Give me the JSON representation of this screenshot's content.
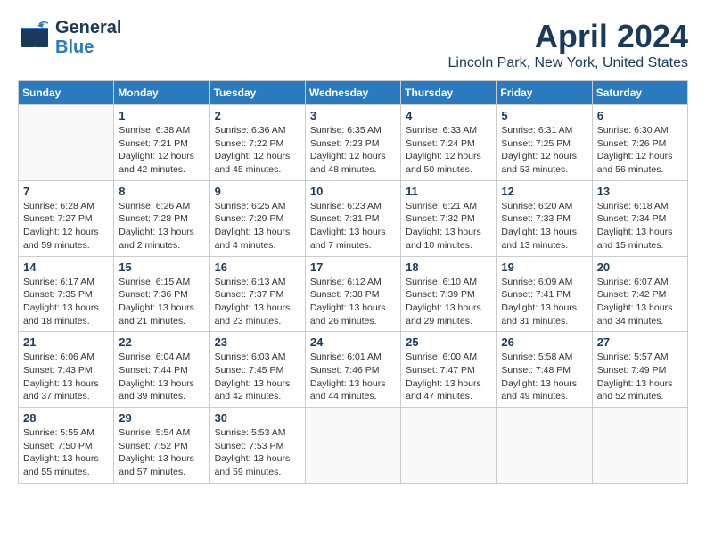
{
  "header": {
    "logo_line1": "General",
    "logo_line2": "Blue",
    "title": "April 2024",
    "subtitle": "Lincoln Park, New York, United States"
  },
  "weekdays": [
    "Sunday",
    "Monday",
    "Tuesday",
    "Wednesday",
    "Thursday",
    "Friday",
    "Saturday"
  ],
  "weeks": [
    [
      {
        "day": "",
        "sunrise": "",
        "sunset": "",
        "daylight": ""
      },
      {
        "day": "1",
        "sunrise": "Sunrise: 6:38 AM",
        "sunset": "Sunset: 7:21 PM",
        "daylight": "Daylight: 12 hours and 42 minutes."
      },
      {
        "day": "2",
        "sunrise": "Sunrise: 6:36 AM",
        "sunset": "Sunset: 7:22 PM",
        "daylight": "Daylight: 12 hours and 45 minutes."
      },
      {
        "day": "3",
        "sunrise": "Sunrise: 6:35 AM",
        "sunset": "Sunset: 7:23 PM",
        "daylight": "Daylight: 12 hours and 48 minutes."
      },
      {
        "day": "4",
        "sunrise": "Sunrise: 6:33 AM",
        "sunset": "Sunset: 7:24 PM",
        "daylight": "Daylight: 12 hours and 50 minutes."
      },
      {
        "day": "5",
        "sunrise": "Sunrise: 6:31 AM",
        "sunset": "Sunset: 7:25 PM",
        "daylight": "Daylight: 12 hours and 53 minutes."
      },
      {
        "day": "6",
        "sunrise": "Sunrise: 6:30 AM",
        "sunset": "Sunset: 7:26 PM",
        "daylight": "Daylight: 12 hours and 56 minutes."
      }
    ],
    [
      {
        "day": "7",
        "sunrise": "Sunrise: 6:28 AM",
        "sunset": "Sunset: 7:27 PM",
        "daylight": "Daylight: 12 hours and 59 minutes."
      },
      {
        "day": "8",
        "sunrise": "Sunrise: 6:26 AM",
        "sunset": "Sunset: 7:28 PM",
        "daylight": "Daylight: 13 hours and 2 minutes."
      },
      {
        "day": "9",
        "sunrise": "Sunrise: 6:25 AM",
        "sunset": "Sunset: 7:29 PM",
        "daylight": "Daylight: 13 hours and 4 minutes."
      },
      {
        "day": "10",
        "sunrise": "Sunrise: 6:23 AM",
        "sunset": "Sunset: 7:31 PM",
        "daylight": "Daylight: 13 hours and 7 minutes."
      },
      {
        "day": "11",
        "sunrise": "Sunrise: 6:21 AM",
        "sunset": "Sunset: 7:32 PM",
        "daylight": "Daylight: 13 hours and 10 minutes."
      },
      {
        "day": "12",
        "sunrise": "Sunrise: 6:20 AM",
        "sunset": "Sunset: 7:33 PM",
        "daylight": "Daylight: 13 hours and 13 minutes."
      },
      {
        "day": "13",
        "sunrise": "Sunrise: 6:18 AM",
        "sunset": "Sunset: 7:34 PM",
        "daylight": "Daylight: 13 hours and 15 minutes."
      }
    ],
    [
      {
        "day": "14",
        "sunrise": "Sunrise: 6:17 AM",
        "sunset": "Sunset: 7:35 PM",
        "daylight": "Daylight: 13 hours and 18 minutes."
      },
      {
        "day": "15",
        "sunrise": "Sunrise: 6:15 AM",
        "sunset": "Sunset: 7:36 PM",
        "daylight": "Daylight: 13 hours and 21 minutes."
      },
      {
        "day": "16",
        "sunrise": "Sunrise: 6:13 AM",
        "sunset": "Sunset: 7:37 PM",
        "daylight": "Daylight: 13 hours and 23 minutes."
      },
      {
        "day": "17",
        "sunrise": "Sunrise: 6:12 AM",
        "sunset": "Sunset: 7:38 PM",
        "daylight": "Daylight: 13 hours and 26 minutes."
      },
      {
        "day": "18",
        "sunrise": "Sunrise: 6:10 AM",
        "sunset": "Sunset: 7:39 PM",
        "daylight": "Daylight: 13 hours and 29 minutes."
      },
      {
        "day": "19",
        "sunrise": "Sunrise: 6:09 AM",
        "sunset": "Sunset: 7:41 PM",
        "daylight": "Daylight: 13 hours and 31 minutes."
      },
      {
        "day": "20",
        "sunrise": "Sunrise: 6:07 AM",
        "sunset": "Sunset: 7:42 PM",
        "daylight": "Daylight: 13 hours and 34 minutes."
      }
    ],
    [
      {
        "day": "21",
        "sunrise": "Sunrise: 6:06 AM",
        "sunset": "Sunset: 7:43 PM",
        "daylight": "Daylight: 13 hours and 37 minutes."
      },
      {
        "day": "22",
        "sunrise": "Sunrise: 6:04 AM",
        "sunset": "Sunset: 7:44 PM",
        "daylight": "Daylight: 13 hours and 39 minutes."
      },
      {
        "day": "23",
        "sunrise": "Sunrise: 6:03 AM",
        "sunset": "Sunset: 7:45 PM",
        "daylight": "Daylight: 13 hours and 42 minutes."
      },
      {
        "day": "24",
        "sunrise": "Sunrise: 6:01 AM",
        "sunset": "Sunset: 7:46 PM",
        "daylight": "Daylight: 13 hours and 44 minutes."
      },
      {
        "day": "25",
        "sunrise": "Sunrise: 6:00 AM",
        "sunset": "Sunset: 7:47 PM",
        "daylight": "Daylight: 13 hours and 47 minutes."
      },
      {
        "day": "26",
        "sunrise": "Sunrise: 5:58 AM",
        "sunset": "Sunset: 7:48 PM",
        "daylight": "Daylight: 13 hours and 49 minutes."
      },
      {
        "day": "27",
        "sunrise": "Sunrise: 5:57 AM",
        "sunset": "Sunset: 7:49 PM",
        "daylight": "Daylight: 13 hours and 52 minutes."
      }
    ],
    [
      {
        "day": "28",
        "sunrise": "Sunrise: 5:55 AM",
        "sunset": "Sunset: 7:50 PM",
        "daylight": "Daylight: 13 hours and 55 minutes."
      },
      {
        "day": "29",
        "sunrise": "Sunrise: 5:54 AM",
        "sunset": "Sunset: 7:52 PM",
        "daylight": "Daylight: 13 hours and 57 minutes."
      },
      {
        "day": "30",
        "sunrise": "Sunrise: 5:53 AM",
        "sunset": "Sunset: 7:53 PM",
        "daylight": "Daylight: 13 hours and 59 minutes."
      },
      {
        "day": "",
        "sunrise": "",
        "sunset": "",
        "daylight": ""
      },
      {
        "day": "",
        "sunrise": "",
        "sunset": "",
        "daylight": ""
      },
      {
        "day": "",
        "sunrise": "",
        "sunset": "",
        "daylight": ""
      },
      {
        "day": "",
        "sunrise": "",
        "sunset": "",
        "daylight": ""
      }
    ]
  ]
}
